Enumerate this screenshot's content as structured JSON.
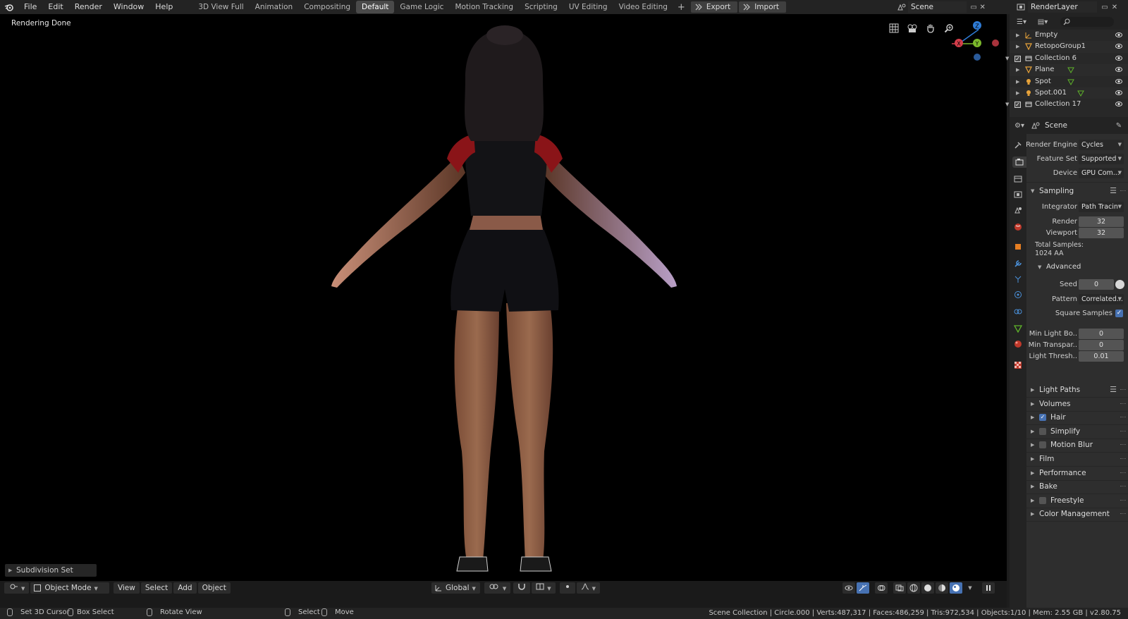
{
  "topbar": {
    "menus": [
      "File",
      "Edit",
      "Render",
      "Window",
      "Help"
    ],
    "workspaces": [
      "3D View Full",
      "Animation",
      "Compositing",
      "Default",
      "Game Logic",
      "Motion Tracking",
      "Scripting",
      "UV Editing",
      "Video Editing"
    ],
    "active_workspace": "Default",
    "add_symbol": "+",
    "export_label": "Export",
    "import_label": "Import",
    "scene": "Scene",
    "render_layer": "RenderLayer"
  },
  "viewport": {
    "status": "Rendering Done",
    "last_operator": "Subdivision Set",
    "gizmo": {
      "z": "Z",
      "y": "Y",
      "x": "X"
    },
    "header": {
      "mode": "Object Mode",
      "menus": [
        "View",
        "Select",
        "Add",
        "Object"
      ],
      "orientation": "Global"
    }
  },
  "outliner": {
    "rows": [
      {
        "label": "Empty",
        "indent": 2,
        "type": "empty"
      },
      {
        "label": "RetopoGroup1",
        "indent": 2,
        "type": "mesh"
      },
      {
        "label": "Collection 6",
        "indent": 1,
        "type": "collection"
      },
      {
        "label": "Plane",
        "indent": 2,
        "type": "mesh"
      },
      {
        "label": "Spot",
        "indent": 2,
        "type": "light"
      },
      {
        "label": "Spot.001",
        "indent": 2,
        "type": "light"
      },
      {
        "label": "Collection 17",
        "indent": 1,
        "type": "collection"
      }
    ]
  },
  "properties": {
    "context": "Scene",
    "render_engine_label": "Render Engine",
    "render_engine": "Cycles",
    "feature_set_label": "Feature Set",
    "feature_set": "Supported",
    "device_label": "Device",
    "device": "GPU Com...",
    "sampling": {
      "title": "Sampling",
      "integrator_label": "Integrator",
      "integrator": "Path Tracin",
      "render_label": "Render",
      "render": "32",
      "viewport_label": "Viewport",
      "viewport": "32",
      "total_label": "Total Samples:",
      "total_value": "1024 AA",
      "advanced": "Advanced",
      "seed_label": "Seed",
      "seed": "0",
      "pattern_label": "Pattern",
      "pattern": "Correlated...",
      "square_samples": "Square Samples",
      "min_light_label": "Min Light Bo..",
      "min_light": "0",
      "min_transp_label": "Min Transpar..",
      "min_transp": "0",
      "light_thresh_label": "Light Thresh..",
      "light_thresh": "0.01"
    },
    "sections": [
      {
        "title": "Light Paths",
        "checkbox": null
      },
      {
        "title": "Volumes",
        "checkbox": null
      },
      {
        "title": "Hair",
        "checkbox": true
      },
      {
        "title": "Simplify",
        "checkbox": false
      },
      {
        "title": "Motion Blur",
        "checkbox": false
      },
      {
        "title": "Film",
        "checkbox": null
      },
      {
        "title": "Performance",
        "checkbox": null
      },
      {
        "title": "Bake",
        "checkbox": null
      },
      {
        "title": "Freestyle",
        "checkbox": false
      },
      {
        "title": "Color Management",
        "checkbox": null
      }
    ]
  },
  "statusbar": {
    "hint1": "Set 3D Cursor",
    "hint2": "Box Select",
    "hint3": "Rotate View",
    "hint4": "Select",
    "hint5": "Move",
    "stats": "Scene Collection | Circle.000 | Verts:487,317 | Faces:486,259 | Tris:972,534 | Objects:1/10 | Mem: 2.55 GB | v2.80.75"
  },
  "colors": {
    "accent_blue": "#4772b3",
    "active_tab": "#4a4a4a",
    "background": "#000000",
    "gizmo_x": "#d43d4a",
    "gizmo_y": "#7bb82b",
    "gizmo_z": "#2e7bd6"
  }
}
